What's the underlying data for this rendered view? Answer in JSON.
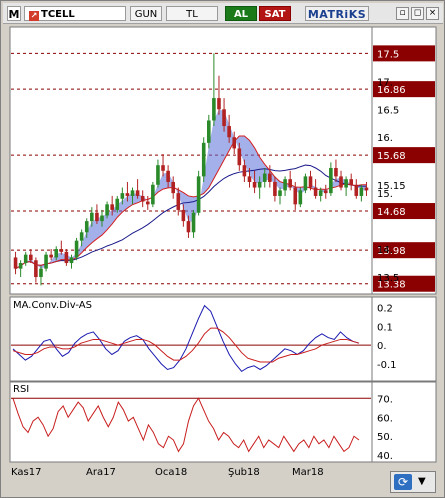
{
  "toolbar": {
    "menu_label": "M",
    "symbol": "TCELL",
    "period_label": "GUN",
    "currency_label": "TL",
    "buy_label": "AL",
    "sell_label": "SAT",
    "brand": "MATRiKS",
    "minimize_glyph": "▫",
    "restore_glyph": "◻",
    "close_glyph": "×"
  },
  "panels": {
    "macd_title": "MA.Conv.Div-AS",
    "rsi_title": "RSI"
  },
  "x_axis_labels": [
    "Kas17",
    "Ara17",
    "Oca18",
    "Şub18",
    "Mar18"
  ],
  "chart_data": [
    {
      "type": "candlestick",
      "y_ticks": [
        "17.",
        "16.5",
        "16.",
        "15.15",
        "15.",
        "14.",
        "13.5"
      ],
      "y_tick_values": [
        17.0,
        16.5,
        16.0,
        15.15,
        15.0,
        14.0,
        13.5
      ],
      "ylim": [
        13.25,
        17.9
      ],
      "level_lines": [
        17.5,
        16.86,
        15.68,
        14.68,
        13.98,
        13.38
      ],
      "level_labels": [
        "17.5",
        "16.86",
        "15.68",
        "14.68",
        "13.98",
        "13.38"
      ],
      "candles": [
        [
          13.85,
          13.95,
          13.55,
          13.65
        ],
        [
          13.65,
          13.8,
          13.5,
          13.75
        ],
        [
          13.75,
          13.95,
          13.7,
          13.9
        ],
        [
          13.9,
          14.0,
          13.75,
          13.8
        ],
        [
          13.8,
          13.85,
          13.4,
          13.5
        ],
        [
          13.5,
          13.7,
          13.35,
          13.65
        ],
        [
          13.65,
          13.95,
          13.6,
          13.9
        ],
        [
          13.9,
          14.0,
          13.8,
          13.85
        ],
        [
          13.85,
          14.05,
          13.8,
          14.0
        ],
        [
          14.0,
          14.15,
          13.9,
          13.95
        ],
        [
          13.95,
          14.0,
          13.7,
          13.75
        ],
        [
          13.75,
          13.9,
          13.65,
          13.85
        ],
        [
          13.85,
          14.2,
          13.8,
          14.15
        ],
        [
          14.15,
          14.35,
          14.05,
          14.3
        ],
        [
          14.3,
          14.55,
          14.2,
          14.5
        ],
        [
          14.5,
          14.75,
          14.4,
          14.65
        ],
        [
          14.65,
          14.8,
          14.45,
          14.5
        ],
        [
          14.5,
          14.7,
          14.4,
          14.6
        ],
        [
          14.6,
          14.85,
          14.55,
          14.8
        ],
        [
          14.8,
          14.95,
          14.6,
          14.7
        ],
        [
          14.7,
          14.95,
          14.65,
          14.9
        ],
        [
          14.9,
          15.1,
          14.8,
          15.0
        ],
        [
          15.0,
          15.2,
          14.85,
          14.95
        ],
        [
          14.95,
          15.1,
          14.8,
          15.05
        ],
        [
          15.05,
          15.25,
          14.9,
          14.95
        ],
        [
          14.95,
          15.05,
          14.75,
          14.85
        ],
        [
          14.85,
          14.95,
          14.7,
          14.8
        ],
        [
          14.8,
          15.2,
          14.75,
          15.15
        ],
        [
          15.15,
          15.6,
          15.1,
          15.5
        ],
        [
          15.5,
          15.7,
          15.3,
          15.4
        ],
        [
          15.4,
          15.5,
          15.1,
          15.2
        ],
        [
          15.2,
          15.3,
          14.9,
          15.0
        ],
        [
          15.0,
          15.1,
          14.6,
          14.7
        ],
        [
          14.7,
          14.8,
          14.4,
          14.5
        ],
        [
          14.5,
          14.6,
          14.2,
          14.3
        ],
        [
          14.3,
          14.7,
          14.2,
          14.65
        ],
        [
          14.65,
          15.4,
          14.6,
          15.3
        ],
        [
          15.3,
          16.0,
          15.2,
          15.9
        ],
        [
          15.9,
          16.4,
          15.8,
          16.3
        ],
        [
          16.3,
          17.5,
          16.2,
          16.7
        ],
        [
          16.7,
          17.1,
          16.4,
          16.5
        ],
        [
          16.5,
          16.7,
          16.1,
          16.2
        ],
        [
          16.2,
          16.4,
          15.9,
          16.0
        ],
        [
          16.0,
          16.1,
          15.7,
          15.8
        ],
        [
          15.8,
          15.9,
          15.4,
          15.5
        ],
        [
          15.5,
          15.6,
          15.2,
          15.3
        ],
        [
          15.3,
          15.45,
          15.1,
          15.2
        ],
        [
          15.2,
          15.4,
          15.0,
          15.1
        ],
        [
          15.1,
          15.3,
          14.9,
          15.2
        ],
        [
          15.2,
          15.45,
          15.1,
          15.35
        ],
        [
          15.35,
          15.5,
          15.1,
          15.2
        ],
        [
          15.2,
          15.3,
          14.85,
          14.95
        ],
        [
          14.95,
          15.1,
          14.8,
          15.05
        ],
        [
          15.05,
          15.3,
          14.95,
          15.25
        ],
        [
          15.25,
          15.4,
          15.05,
          15.1
        ],
        [
          15.1,
          15.2,
          14.7,
          14.8
        ],
        [
          14.8,
          15.1,
          14.75,
          15.05
        ],
        [
          15.05,
          15.35,
          15.0,
          15.3
        ],
        [
          15.3,
          15.4,
          15.05,
          15.1
        ],
        [
          15.1,
          15.25,
          14.9,
          14.95
        ],
        [
          14.95,
          15.1,
          14.85,
          15.05
        ],
        [
          15.05,
          15.15,
          14.9,
          15.0
        ],
        [
          15.0,
          15.55,
          14.95,
          15.45
        ],
        [
          15.45,
          15.6,
          15.2,
          15.3
        ],
        [
          15.3,
          15.4,
          15.05,
          15.1
        ],
        [
          15.1,
          15.3,
          14.95,
          15.25
        ],
        [
          15.25,
          15.35,
          15.05,
          15.15
        ],
        [
          15.15,
          15.25,
          14.9,
          14.95
        ],
        [
          14.95,
          15.15,
          14.85,
          15.1
        ],
        [
          15.1,
          15.2,
          14.95,
          15.05
        ]
      ],
      "colors": {
        "up": "#2a8a2a",
        "down": "#b22222",
        "ma_fast": "#d42020",
        "ma_slow": "#1a1a8a",
        "band": "#5a6fd8",
        "grid": "#8b0000",
        "plot_bg": "#ffffff",
        "axis_bg": "#ffffff"
      }
    },
    {
      "type": "line",
      "title": "MA.Conv.Div-AS",
      "y_ticks": [
        "0.2",
        "0.1",
        "0.",
        "-0.1"
      ],
      "y_tick_values": [
        0.2,
        0.1,
        0.0,
        -0.1
      ],
      "ylim": [
        -0.17,
        0.24
      ],
      "zero_line": 0.0,
      "series": [
        {
          "color": "#1a1ab0",
          "values": [
            -0.02,
            -0.05,
            -0.08,
            -0.06,
            -0.02,
            0.02,
            0.03,
            -0.02,
            -0.06,
            -0.04,
            0.01,
            0.04,
            0.06,
            0.07,
            0.03,
            -0.02,
            -0.05,
            -0.03,
            0.02,
            0.04,
            0.05,
            0.03,
            -0.02,
            -0.06,
            -0.1,
            -0.13,
            -0.12,
            -0.08,
            -0.02,
            0.06,
            0.14,
            0.21,
            0.18,
            0.1,
            0.02,
            -0.05,
            -0.1,
            -0.14,
            -0.12,
            -0.11,
            -0.13,
            -0.11,
            -0.08,
            -0.05,
            -0.02,
            -0.03,
            -0.05,
            -0.03,
            0.01,
            0.04,
            0.06,
            0.04,
            0.03,
            0.07,
            0.04,
            0.02,
            0.01
          ]
        },
        {
          "color": "#c81e1e",
          "values": [
            -0.03,
            -0.04,
            -0.05,
            -0.05,
            -0.04,
            -0.02,
            -0.01,
            -0.01,
            -0.02,
            -0.02,
            -0.01,
            0.01,
            0.02,
            0.03,
            0.03,
            0.02,
            0.01,
            0.0,
            0.01,
            0.02,
            0.03,
            0.03,
            0.02,
            0.0,
            -0.03,
            -0.06,
            -0.08,
            -0.08,
            -0.06,
            -0.03,
            0.01,
            0.06,
            0.09,
            0.09,
            0.07,
            0.04,
            0.0,
            -0.04,
            -0.07,
            -0.08,
            -0.09,
            -0.09,
            -0.09,
            -0.07,
            -0.06,
            -0.05,
            -0.05,
            -0.04,
            -0.03,
            -0.02,
            0.0,
            0.01,
            0.02,
            0.03,
            0.03,
            0.02,
            0.01
          ]
        }
      ]
    },
    {
      "type": "line",
      "title": "RSI",
      "y_ticks": [
        "70.",
        "60.",
        "50.",
        "40."
      ],
      "y_tick_values": [
        70,
        60,
        50,
        40
      ],
      "ylim": [
        38,
        77
      ],
      "level_lines": [
        70
      ],
      "series": [
        {
          "color": "#c81e1e",
          "values": [
            70,
            62,
            55,
            52,
            58,
            60,
            56,
            50,
            54,
            63,
            66,
            60,
            64,
            68,
            65,
            58,
            62,
            66,
            60,
            55,
            60,
            68,
            64,
            58,
            60,
            54,
            48,
            56,
            52,
            46,
            44,
            50,
            48,
            42,
            46,
            58,
            66,
            70,
            64,
            58,
            54,
            48,
            52,
            50,
            46,
            44,
            48,
            42,
            46,
            50,
            44,
            48,
            46,
            44,
            50,
            46,
            42,
            46,
            48,
            44,
            50,
            46,
            48,
            44,
            50,
            46,
            42,
            44,
            50,
            48
          ]
        }
      ]
    }
  ]
}
